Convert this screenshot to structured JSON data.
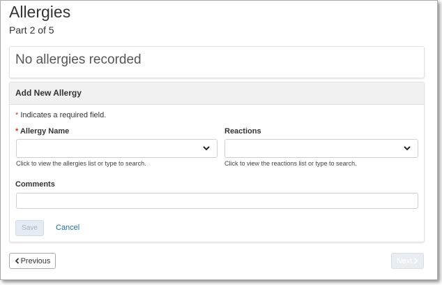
{
  "page": {
    "title": "Allergies",
    "subtitle": "Part 2 of 5"
  },
  "empty_state": {
    "text": "No allergies recorded"
  },
  "form": {
    "header": "Add New Allergy",
    "required_marker": "*",
    "required_note": "Indicates a required field.",
    "allergy_name": {
      "label": "Allergy Name",
      "value": "",
      "help": "Click to view the allergies list or type to search.",
      "icon": "chevron-down-icon"
    },
    "reactions": {
      "label": "Reactions",
      "value": "",
      "help": "Click to view the reactions list or type to search.",
      "icon": "chevron-down-icon"
    },
    "comments": {
      "label": "Comments",
      "value": ""
    },
    "save_label": "Save",
    "cancel_label": "Cancel"
  },
  "navigation": {
    "previous_label": "Previous",
    "previous_icon": "chevron-left-icon",
    "next_label": "Next",
    "next_icon": "chevron-right-icon"
  },
  "colors": {
    "required": "#c0392b",
    "link": "#1f6ea8",
    "disabled_button_bg": "#e4ebf2"
  }
}
